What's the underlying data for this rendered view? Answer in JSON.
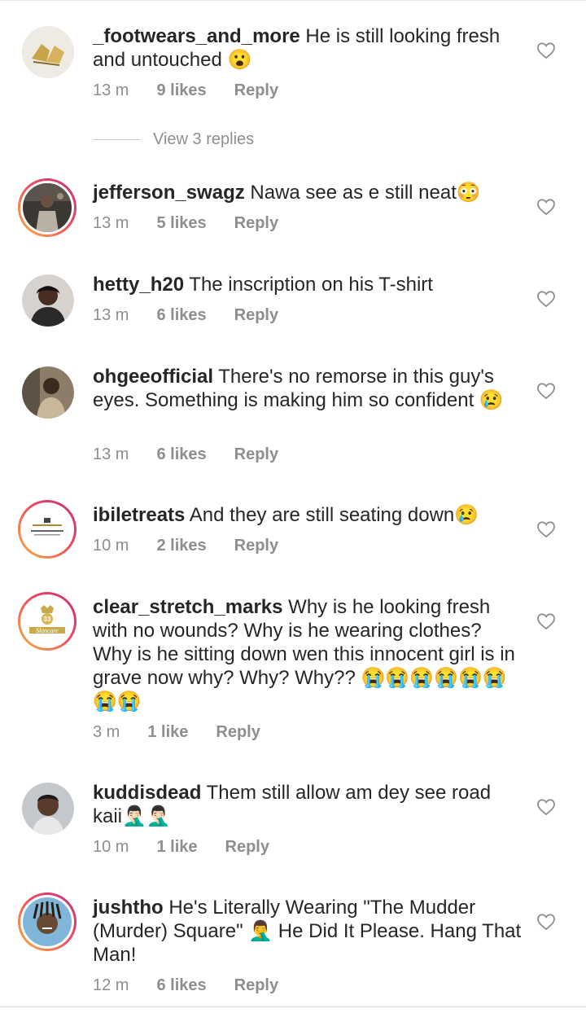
{
  "comments": [
    {
      "username": "_footwears_and_more",
      "text": " He is still looking fresh and untouched 😮",
      "time": "13 m",
      "likes": "9 likes",
      "reply": "Reply",
      "avatar": "shoe-avatar",
      "story_ring": false
    },
    {
      "username": "jefferson_swagz",
      "text": " Nawa see as e  still neat😳",
      "time": "13 m",
      "likes": "5 likes",
      "reply": "Reply",
      "avatar": "studio-avatar",
      "story_ring": true
    },
    {
      "username": "hetty_h20",
      "text": " The inscription on his T-shirt",
      "time": "13 m",
      "likes": "6 likes",
      "reply": "Reply",
      "avatar": "portrait-avatar",
      "story_ring": false
    },
    {
      "username": "ohgeeofficial",
      "text": " There's no remorse in this guy's eyes. Something is making him so confident 😢",
      "time": "13 m",
      "likes": "6 likes",
      "reply": "Reply",
      "avatar": "portrait-avatar",
      "story_ring": false
    },
    {
      "username": "ibiletreats",
      "text": " And they are still seating down😢",
      "time": "10 m",
      "likes": "2 likes",
      "reply": "Reply",
      "avatar": "logo-avatar",
      "story_ring": true
    },
    {
      "username": "clear_stretch_marks",
      "text": " Why is he looking fresh with no wounds? Why is he wearing clothes? Why is he sitting down wen this innocent girl is in grave now why? Why? Why?? 😭😭😭😭😭😭😭😭",
      "time": "3 m",
      "likes": "1 like",
      "reply": "Reply",
      "avatar": "skincare-logo-avatar",
      "story_ring": true
    },
    {
      "username": "kuddisdead",
      "text": " Them still allow am dey see road kaii🤦🏻‍♂️🤦🏻‍♂️",
      "time": "10 m",
      "likes": "1 like",
      "reply": "Reply",
      "avatar": "portrait-avatar",
      "story_ring": false
    },
    {
      "username": "jushtho",
      "text": " He's Literally Wearing \"The Mudder (Murder) Square\" 🤦‍♂️ He Did It Please. Hang That Man!",
      "time": "12 m",
      "likes": "6 likes",
      "reply": "Reply",
      "avatar": "portrait-avatar",
      "story_ring": true
    }
  ],
  "view_replies": {
    "label": "View 3 replies"
  },
  "logos": {
    "skincare_text": "Skincare",
    "skincare_badge": "33"
  },
  "colors": {
    "text": "#262626",
    "meta": "#8e8e8e",
    "ring_start": "#f6b540",
    "ring_end": "#c1317f"
  }
}
